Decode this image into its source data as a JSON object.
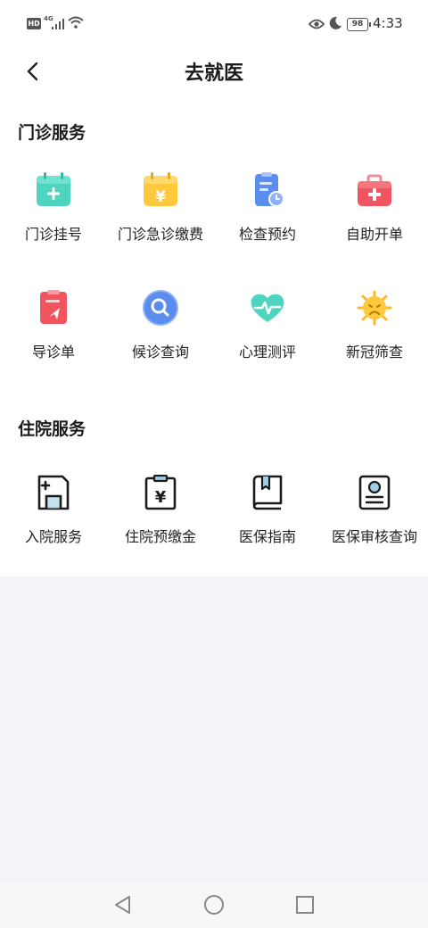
{
  "status_bar": {
    "time": "4:33",
    "battery": "98",
    "network": "4G",
    "hd": "HD"
  },
  "header": {
    "title": "去就医"
  },
  "outpatient": {
    "title": "门诊服务",
    "items": [
      {
        "label": "门诊挂号",
        "icon": "calendar-plus-icon"
      },
      {
        "label": "门诊急诊缴费",
        "icon": "calendar-yuan-icon"
      },
      {
        "label": "检查预约",
        "icon": "clipboard-clock-icon"
      },
      {
        "label": "自助开单",
        "icon": "medical-kit-icon"
      },
      {
        "label": "导诊单",
        "icon": "clipboard-send-icon"
      },
      {
        "label": "候诊查询",
        "icon": "search-bubble-icon"
      },
      {
        "label": "心理测评",
        "icon": "heart-pulse-icon"
      },
      {
        "label": "新冠筛查",
        "icon": "virus-icon"
      }
    ]
  },
  "inpatient": {
    "title": "住院服务",
    "items": [
      {
        "label": "入院服务",
        "icon": "admission-doc-icon"
      },
      {
        "label": "住院预缴金",
        "icon": "clipboard-yuan-icon"
      },
      {
        "label": "医保指南",
        "icon": "book-bookmark-icon"
      },
      {
        "label": "医保审核查询",
        "icon": "insurance-card-icon"
      }
    ]
  },
  "colors": {
    "teal": "#4fd4c0",
    "yellow": "#ffc83d",
    "blue": "#5b8def",
    "red": "#f0555f",
    "orange": "#ffb627",
    "background": "#f3f4f8"
  }
}
